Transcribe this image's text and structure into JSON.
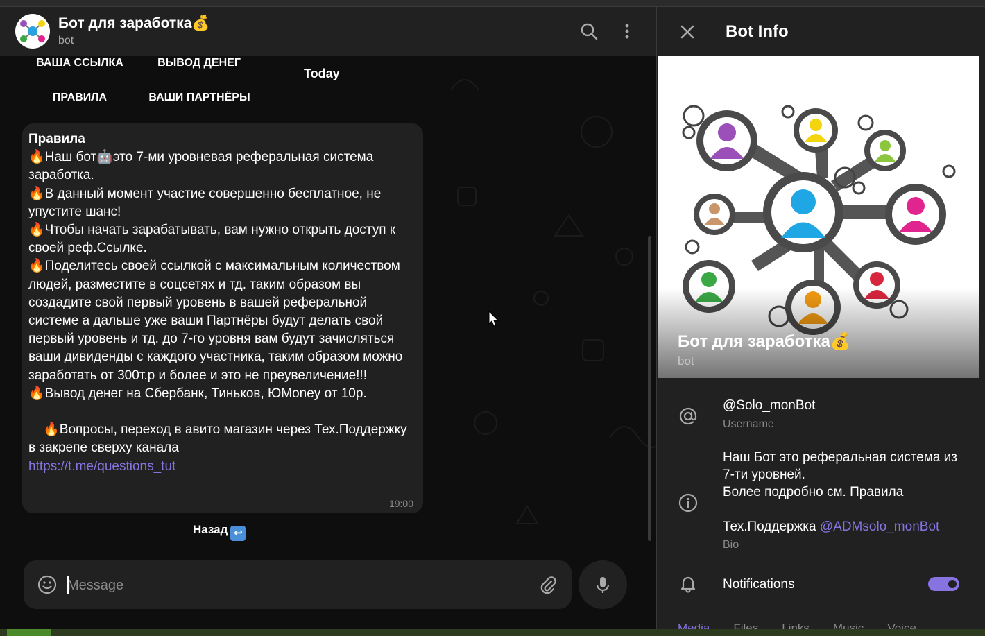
{
  "chat": {
    "title": "Бот для заработка",
    "title_emoji": "💰",
    "subtitle": "bot",
    "keyboard": {
      "row1": [
        "ВАША ССЫЛКА",
        "ВЫВОД ДЕНЕГ"
      ],
      "row2": [
        "ПРАВИЛА",
        "ВАШИ ПАРТНЁРЫ"
      ]
    },
    "date_chip": "Today",
    "message": {
      "heading": "Правила",
      "body": "🔥Наш бот🤖это 7-ми уровневая реферальная система заработка.\n🔥В данный момент участие совершенно бесплатное, не упустите шанс!\n🔥Чтобы начать зарабатывать, вам нужно открыть доступ к своей реф.Ссылке.\n🔥Поделитесь своей ссылкой с максимальным количеством людей, разместите в соцсетях и тд. таким образом вы создадите свой первый уровень в вашей реферальной системе а дальше уже ваши Партнёры будут делать свой первый уровень и тд. до 7-го уровня вам будут зачисляться ваши дивиденды с каждого участника, таким образом можно заработать от 300т.р и более и это не преувеличение!!!\n🔥Вывод денег на Сбербанк, Тиньков, ЮMoney от 10р.\n\n    🔥Вопросы, переход в авито магазин через Тех.Поддержку в закрепе сверху канала",
      "link": "https://t.me/questions_tut",
      "time": "19:00"
    },
    "back_button": "Назад",
    "back_emoji": "↩",
    "composer_placeholder": "Message"
  },
  "info": {
    "title": "Bot Info",
    "name": "Бот для заработка",
    "name_emoji": "💰",
    "type": "bot",
    "username": "@Solo_monBot",
    "username_label": "Username",
    "bio_text": "Наш Бот это реферальная система из 7-ти уровней.\nБолее подробно см. Правила\n\nТех.Поддержка ",
    "bio_link": "@ADMsolo_monBot",
    "bio_label": "Bio",
    "notifications_label": "Notifications",
    "notifications_on": true,
    "tabs": [
      "Media",
      "Files",
      "Links",
      "Music",
      "Voice"
    ]
  },
  "colors": {
    "accent": "#8774e1",
    "panel": "#212121",
    "chat_bg": "#0e0e0e"
  }
}
